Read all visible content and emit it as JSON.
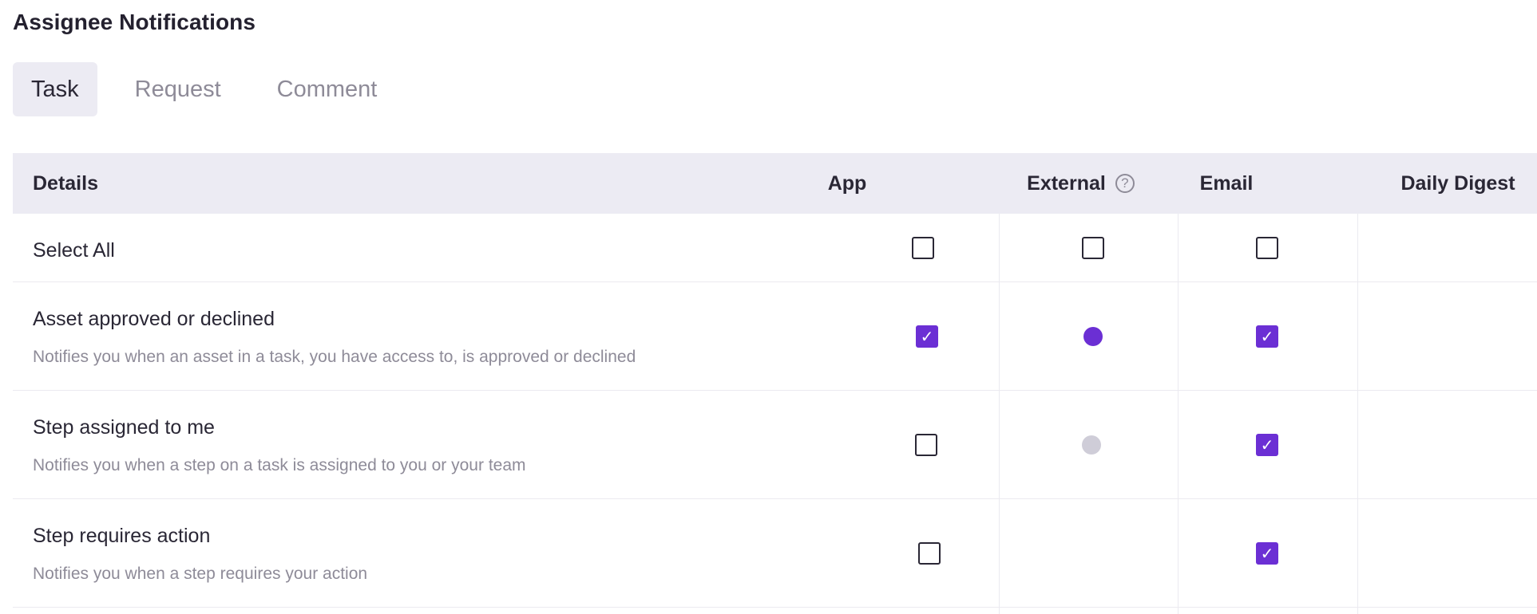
{
  "page": {
    "title": "Assignee Notifications"
  },
  "tabs": [
    {
      "label": "Task",
      "active": true
    },
    {
      "label": "Request",
      "active": false
    },
    {
      "label": "Comment",
      "active": false
    }
  ],
  "table": {
    "headers": {
      "details": "Details",
      "app": "App",
      "external": "External",
      "email": "Email",
      "daily_digest": "Daily Digest"
    },
    "help_icon_glyph": "?",
    "check_glyph": "✓",
    "rows": [
      {
        "title": "Select All",
        "description": "",
        "app": false,
        "external": "checkbox-unchecked",
        "email": false
      },
      {
        "title": "Asset approved or declined",
        "description": "Notifies you when an asset in a task, you have access to, is approved or declined",
        "app": true,
        "external": "dot-active",
        "email": true
      },
      {
        "title": "Step assigned to me",
        "description": "Notifies you when a step on a task is assigned to you or your team",
        "app": false,
        "external": "dot-disabled",
        "email": true
      },
      {
        "title": "Step requires action",
        "description": "Notifies you when a step requires your action",
        "app": false,
        "external": "none",
        "email": true
      }
    ]
  },
  "colors": {
    "accent": "#6b2fd4",
    "dot_active": "#6b2fd4",
    "dot_disabled": "#cfcdd8",
    "header_bg": "#ecebf3",
    "muted_text": "#8e8b98"
  }
}
